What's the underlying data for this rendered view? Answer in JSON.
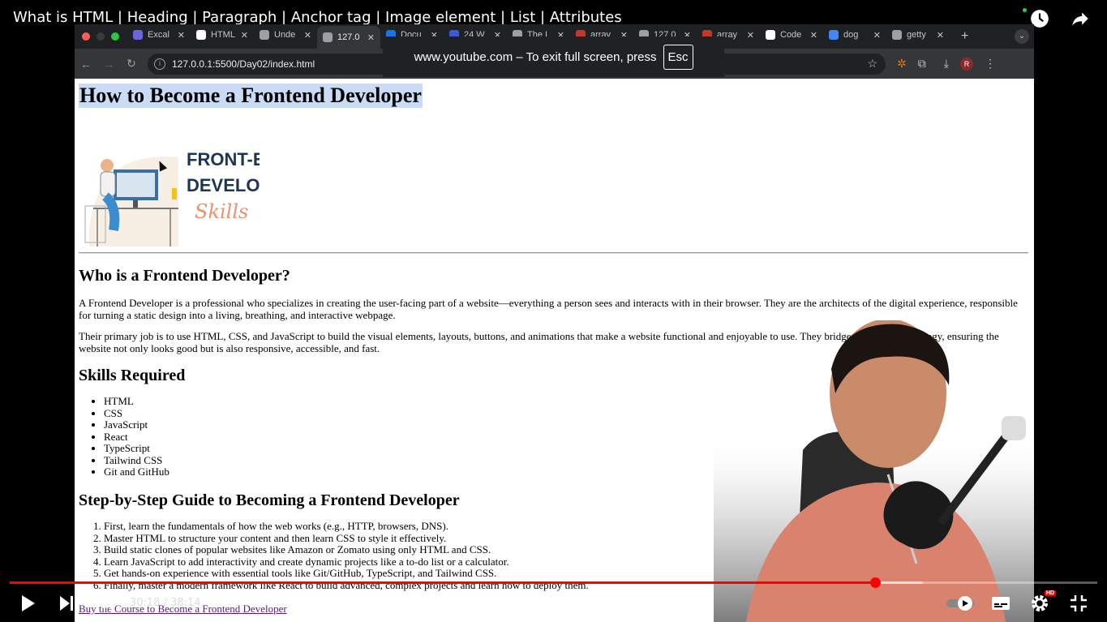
{
  "video": {
    "title": "What is HTML | Heading | Paragraph | Anchor tag | Image element | List | Attributes",
    "time_current": "30:18",
    "time_total": "38:14",
    "time_display": "30:18 / 38:14",
    "progress_played": 0.796,
    "progress_loaded": 0.84,
    "hd_badge": "HD"
  },
  "browser": {
    "tabs": [
      {
        "label": "Excal",
        "favicon_color": "#6965db"
      },
      {
        "label": "HTML",
        "favicon_color": "#ffffff"
      },
      {
        "label": "Unde",
        "favicon_color": "#9aa0a6"
      },
      {
        "label": "127.0",
        "favicon_color": "#9aa0a6",
        "active": true
      },
      {
        "label": "Docu",
        "favicon_color": "#1a73e8"
      },
      {
        "label": "24 W",
        "favicon_color": "#3b5bdb"
      },
      {
        "label": "The I",
        "favicon_color": "#9aa0a6"
      },
      {
        "label": "array",
        "favicon_color": "#c0392b"
      },
      {
        "label": "127.0",
        "favicon_color": "#9aa0a6"
      },
      {
        "label": "array",
        "favicon_color": "#c0392b"
      },
      {
        "label": "Code",
        "favicon_color": "#ffffff"
      },
      {
        "label": "dog",
        "favicon_color": "#4285f4"
      },
      {
        "label": "getty",
        "favicon_color": "#9aa0a6"
      }
    ],
    "url": "127.0.0.1:5500/Day02/index.html",
    "avatar_letter": "R",
    "fullscreen_toast": "www.youtube.com – To exit full screen, press",
    "esc_key": "Esc"
  },
  "page": {
    "h1": "How to Become a Frontend Developer",
    "hero": {
      "line1": "FRONT-END",
      "line2": "DEVELOPER",
      "line3": "Skills"
    },
    "h2_who": "Who is a Frontend Developer?",
    "p1": "A Frontend Developer is a professional who specializes in creating the user-facing part of a website—everything a person sees and interacts with in their browser. They are the architects of the digital experience, responsible for turning a static design into a living, breathing, and interactive webpage.",
    "p2": "Their primary job is to use HTML, CSS, and JavaScript to build the visual elements, layouts, buttons, and animations that make a website functional and enjoyable to use. They bridge the g… d technology, ensuring the website not only looks good but is also responsive, accessible, and fast.",
    "h2_skills": "Skills Required",
    "skills": [
      "HTML",
      "CSS",
      "JavaScript",
      "React",
      "TypeScript",
      "Tailwind CSS",
      "Git and GitHub"
    ],
    "h2_steps": "Step-by-Step Guide to Becoming a Frontend Developer",
    "steps": [
      "First, learn the fundamentals of how the web works (e.g., HTTP, browsers, DNS).",
      "Master HTML to structure your content and then learn CSS to style it effectively.",
      "Build static clones of popular websites like Amazon or Zomato using only HTML and CSS.",
      "Learn JavaScript to add interactivity and create dynamic projects like a to-do list or a calculator.",
      "Get hands-on experience with essential tools like Git/GitHub, TypeScript, and Tailwind CSS.",
      "Finally, master a modern framework like React to build advanced, complex projects and learn how to deploy them."
    ],
    "link": "Buy the Course to Become a Frontend Developer"
  },
  "colors": {
    "accent": "#ff0000",
    "selection": "#c9dbf5",
    "link": "#551a8b"
  }
}
